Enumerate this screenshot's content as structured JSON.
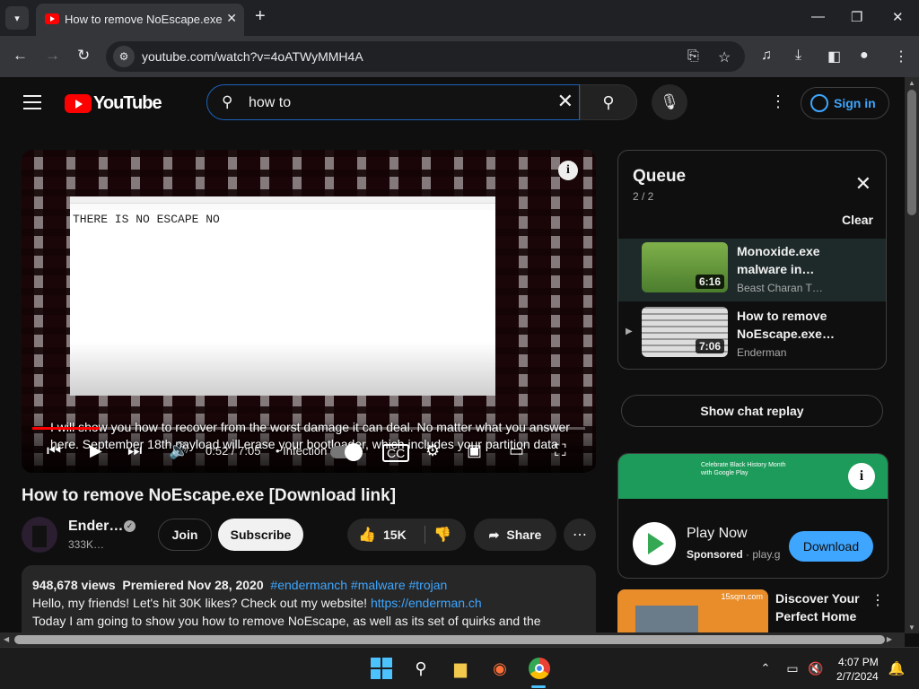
{
  "browser": {
    "tab_title": "How to remove NoEscape.exe [",
    "url": "youtube.com/watch?v=4oATWyMMH4A"
  },
  "youtube": {
    "logo_text": "YouTube",
    "search_value": "how to",
    "sign_in": "Sign in"
  },
  "player": {
    "notepad_text": "THERE IS NO ESCAPE NO",
    "caption_line1": "I will show you how to recover from the worst damage it can deal. No matter what you answer",
    "caption_line2": "here. September 18th payload will erase your bootloader, which includes your partition data",
    "time": "0:52 / 7:05",
    "chapter": "• Infection",
    "progress_fraction": 0.122
  },
  "video": {
    "title": "How to remove NoEscape.exe [Download link]",
    "channel": "Ender…",
    "subscribers": "333K…",
    "join": "Join",
    "subscribe": "Subscribe",
    "likes": "15K",
    "share": "Share"
  },
  "description": {
    "views": "948,678 views",
    "premiered": "Premiered Nov 28, 2020",
    "tags": "#endermanch #malware #trojan",
    "line2_text": "Hello, my friends! Let's hit 30K likes? Check out my website!",
    "line2_link": "https://enderman.ch",
    "line3": "Today I am going to show you how to remove NoEscape, as well as its set of quirks and the"
  },
  "queue": {
    "title": "Queue",
    "count": "2 / 2",
    "clear": "Clear",
    "items": [
      {
        "title": "Monoxide.exe malware in…",
        "channel": "Beast Charan T…",
        "duration": "6:16"
      },
      {
        "title": "How to remove NoEscape.exe…",
        "channel": "Enderman",
        "duration": "7:06"
      }
    ]
  },
  "chat_replay": "Show chat replay",
  "ad": {
    "banner_text": "Celebrate Black History Month with Google Play",
    "name": "Play Now",
    "sponsored": "Sponsored",
    "domain": "· play.g",
    "cta": "Download"
  },
  "recommended": {
    "title": "Discover Your Perfect Home",
    "thumb_text": "15sqm.com"
  },
  "taskbar": {
    "time": "4:07 PM",
    "date": "2/7/2024"
  },
  "colors": {
    "accent_blue": "#3ea6ff",
    "youtube_red": "#ff0000"
  }
}
